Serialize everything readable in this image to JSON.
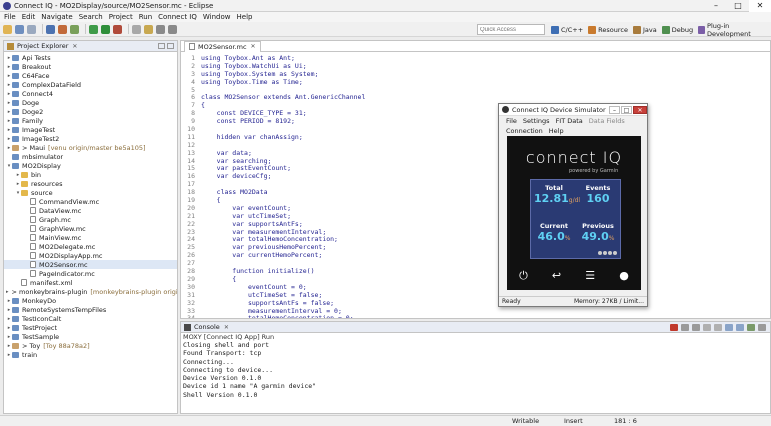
{
  "window": {
    "title": "Connect IQ - MO2Display/source/MO2Sensor.mc - Eclipse",
    "controls": [
      "–",
      "□",
      "✕"
    ]
  },
  "menu": [
    "File",
    "Edit",
    "Navigate",
    "Search",
    "Project",
    "Run",
    "Connect IQ",
    "Window",
    "Help"
  ],
  "toolbar": {
    "quick_access_placeholder": "Quick Access",
    "perspectives": [
      {
        "label": "C/C++",
        "color": "#3e6eb4"
      },
      {
        "label": "Resource",
        "color": "#c97a2d"
      },
      {
        "label": "Java",
        "color": "#a87b3c"
      },
      {
        "label": "Debug",
        "color": "#4f8f4f"
      },
      {
        "label": "Plug-in Development",
        "color": "#7b5ea7"
      }
    ]
  },
  "explorer": {
    "title": "Project Explorer",
    "items": [
      {
        "label": "Api Tests",
        "type": "project",
        "indent": 0,
        "tw": "▸"
      },
      {
        "label": "Breakout",
        "type": "project",
        "indent": 0,
        "tw": "▸"
      },
      {
        "label": "C64Face",
        "type": "project",
        "indent": 0,
        "tw": "▸"
      },
      {
        "label": "ComplexDataField",
        "type": "project",
        "indent": 0,
        "tw": "▸"
      },
      {
        "label": "Connect4",
        "type": "project",
        "indent": 0,
        "tw": "▸"
      },
      {
        "label": "Doge",
        "type": "project",
        "indent": 0,
        "tw": "▸"
      },
      {
        "label": "Doge2",
        "type": "project",
        "indent": 0,
        "tw": "▸"
      },
      {
        "label": "Family",
        "type": "project",
        "indent": 0,
        "tw": "▸"
      },
      {
        "label": "ImageTest",
        "type": "project",
        "indent": 0,
        "tw": "▸"
      },
      {
        "label": "ImageTest2",
        "type": "project",
        "indent": 0,
        "tw": "▸"
      },
      {
        "label": "> Maui",
        "type": "git",
        "indent": 0,
        "tw": "▸",
        "deco": "[venu origin/master be5a105]"
      },
      {
        "label": "mbsimulator",
        "type": "project",
        "indent": 0,
        "tw": ""
      },
      {
        "label": "MO2Display",
        "type": "project",
        "indent": 0,
        "tw": "▾"
      },
      {
        "label": "bin",
        "type": "folder",
        "indent": 1,
        "tw": "▸"
      },
      {
        "label": "resources",
        "type": "folder",
        "indent": 1,
        "tw": "▸"
      },
      {
        "label": "source",
        "type": "folder",
        "indent": 1,
        "tw": "▾"
      },
      {
        "label": "CommandView.mc",
        "type": "file",
        "indent": 2,
        "tw": ""
      },
      {
        "label": "DataView.mc",
        "type": "file",
        "indent": 2,
        "tw": ""
      },
      {
        "label": "Graph.mc",
        "type": "file",
        "indent": 2,
        "tw": ""
      },
      {
        "label": "GraphView.mc",
        "type": "file",
        "indent": 2,
        "tw": ""
      },
      {
        "label": "MainView.mc",
        "type": "file",
        "indent": 2,
        "tw": ""
      },
      {
        "label": "MO2Delegate.mc",
        "type": "file",
        "indent": 2,
        "tw": ""
      },
      {
        "label": "MO2DisplayApp.mc",
        "type": "file",
        "indent": 2,
        "tw": ""
      },
      {
        "label": "MO2Sensor.mc",
        "type": "file",
        "indent": 2,
        "tw": ""
      },
      {
        "label": "PageIndicator.mc",
        "type": "file",
        "indent": 2,
        "tw": ""
      },
      {
        "label": "manifest.xml",
        "type": "file",
        "indent": 1,
        "tw": ""
      },
      {
        "label": "> monkeybrains-plugin",
        "type": "git",
        "indent": 0,
        "tw": "▸",
        "deco": "[monkeybrains-plugin origin/de"
      },
      {
        "label": "MonkeyDo",
        "type": "project",
        "indent": 0,
        "tw": "▸"
      },
      {
        "label": "RemoteSystemsTempFiles",
        "type": "project",
        "indent": 0,
        "tw": "▸"
      },
      {
        "label": "TestIconCalt",
        "type": "project",
        "indent": 0,
        "tw": "▸"
      },
      {
        "label": "TestProject",
        "type": "project",
        "indent": 0,
        "tw": "▸"
      },
      {
        "label": "TestSample",
        "type": "project",
        "indent": 0,
        "tw": "▸"
      },
      {
        "label": "> Toy",
        "type": "git",
        "indent": 0,
        "tw": "▸",
        "deco": "[Toy 88a78a2]"
      },
      {
        "label": "train",
        "type": "project",
        "indent": 0,
        "tw": "▸"
      }
    ]
  },
  "editor": {
    "tab": "MO2Sensor.mc",
    "lines": [
      {
        "n": "1",
        "t": "using Toybox.Ant as Ant;"
      },
      {
        "n": "2",
        "t": "using Toybox.WatchUi as Ui;"
      },
      {
        "n": "3",
        "t": "using Toybox.System as System;"
      },
      {
        "n": "4",
        "t": "using Toybox.Time as Time;"
      },
      {
        "n": "5",
        "t": ""
      },
      {
        "n": "6",
        "t": "class MO2Sensor extends Ant.GenericChannel"
      },
      {
        "n": "7",
        "t": "{"
      },
      {
        "n": "8",
        "t": "    const DEVICE_TYPE = 31;"
      },
      {
        "n": "9",
        "t": "    const PERIOD = 8192;"
      },
      {
        "n": "10",
        "t": ""
      },
      {
        "n": "11",
        "t": "    hidden var chanAssign;"
      },
      {
        "n": "12",
        "t": ""
      },
      {
        "n": "13",
        "t": "    var data;"
      },
      {
        "n": "14",
        "t": "    var searching;"
      },
      {
        "n": "15",
        "t": "    var pastEventCount;"
      },
      {
        "n": "16",
        "t": "    var deviceCfg;"
      },
      {
        "n": "17",
        "t": ""
      },
      {
        "n": "18",
        "t": "    class MO2Data"
      },
      {
        "n": "19",
        "t": "    {"
      },
      {
        "n": "20",
        "t": "        var eventCount;"
      },
      {
        "n": "21",
        "t": "        var utcTimeSet;"
      },
      {
        "n": "22",
        "t": "        var supportsAntFs;"
      },
      {
        "n": "23",
        "t": "        var measurementInterval;"
      },
      {
        "n": "24",
        "t": "        var totalHemoConcentration;"
      },
      {
        "n": "25",
        "t": "        var previousHemoPercent;"
      },
      {
        "n": "26",
        "t": "        var currentHemoPercent;"
      },
      {
        "n": "27",
        "t": ""
      },
      {
        "n": "28",
        "t": "        function initialize()"
      },
      {
        "n": "29",
        "t": "        {"
      },
      {
        "n": "30",
        "t": "            eventCount = 0;"
      },
      {
        "n": "31",
        "t": "            utcTimeSet = false;"
      },
      {
        "n": "32",
        "t": "            supportsAntFs = false;"
      },
      {
        "n": "33",
        "t": "            measurementInterval = 0;"
      },
      {
        "n": "34",
        "t": "            totalHemoConcentration = 0;"
      }
    ]
  },
  "console": {
    "tab": "Console",
    "header": "MOXY [Connect IQ App] Run",
    "lines": [
      "Closing shell and port",
      "Found Transport: tcp",
      "Connecting...",
      "Connecting to device...",
      "Device Version 0.1.0",
      "Device id 1 name \"A garmin device\"",
      "Shell Version 0.1.0"
    ]
  },
  "status": {
    "writable": "Writable",
    "insert": "Insert",
    "position": "181 : 6"
  },
  "simulator": {
    "title": "Connect IQ Device Simulator",
    "menu1": [
      "File",
      "Settings",
      "FIT Data",
      "Data Fields"
    ],
    "menu2": [
      "Connection",
      "Help"
    ],
    "logo": "connect IQ",
    "logo_sub": "powered by Garmin",
    "metrics": {
      "total_label": "Total",
      "total_value": "12.81",
      "total_unit": "g/dl",
      "events_label": "Events",
      "events_value": "160",
      "current_label": "Current",
      "current_value": "46.0",
      "current_unit": "%",
      "previous_label": "Previous",
      "previous_value": "49.0",
      "previous_unit": "%"
    },
    "status_left": "Ready",
    "status_mem": "Memory: 27KB / Limit..."
  }
}
